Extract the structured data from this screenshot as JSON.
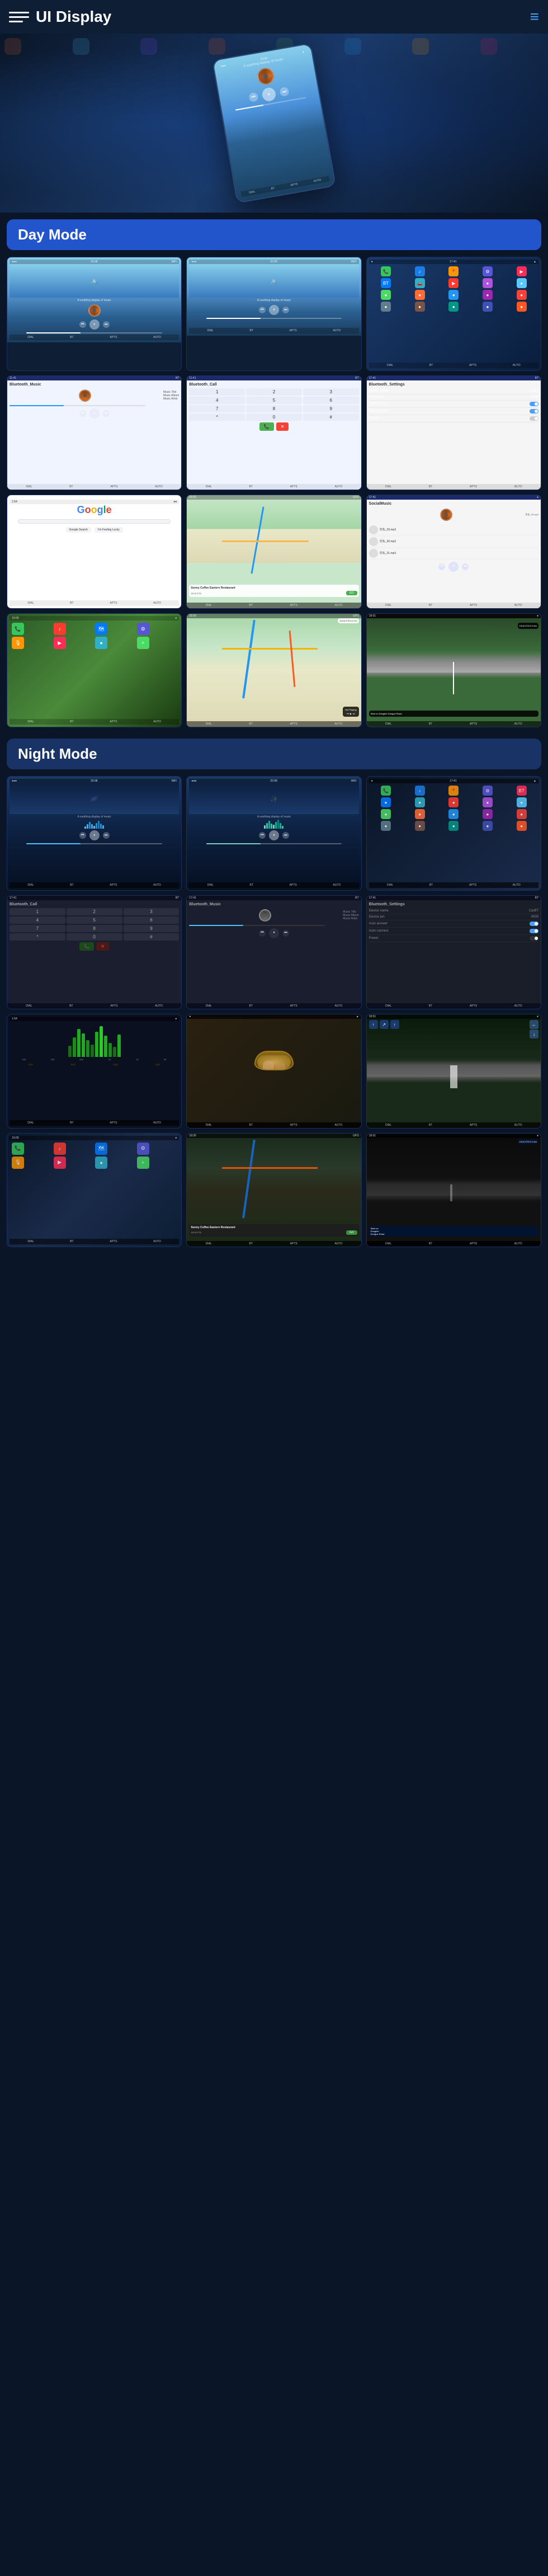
{
  "app": {
    "title": "UI Display",
    "menu_icon": "≡",
    "hamburger_lines": 3
  },
  "header": {
    "title": "UI Display",
    "nav_color": "#4a9eff"
  },
  "sections": {
    "day_mode": "Day Mode",
    "night_mode": "Night Mode"
  },
  "day_screens": {
    "music1": {
      "time": "20:08",
      "subtitle": "A soothing display of music",
      "controls": [
        "⏮",
        "⏸",
        "⏭"
      ]
    },
    "music2": {
      "time": "20:08",
      "subtitle": "A soothing display of music"
    },
    "bluetooth_music": {
      "title": "Bluetooth_Music",
      "track_title": "Music Title",
      "album": "Music Album",
      "artist": "Music Artist"
    },
    "bluetooth_call": {
      "title": "Bluetooth_Call",
      "numbers": [
        "1",
        "2",
        "3",
        "4",
        "5",
        "6",
        "7",
        "8",
        "9",
        "*",
        "0",
        "#"
      ]
    },
    "bluetooth_settings": {
      "title": "Bluetooth_Settings",
      "device_name_label": "Device name",
      "device_name_value": "CarBT",
      "device_pin_label": "Device pin",
      "device_pin_value": "0000",
      "auto_answer_label": "Auto answer",
      "auto_connect_label": "Auto connect",
      "power_label": "Power"
    },
    "google": {
      "logo": "Google",
      "logo_parts": [
        "G",
        "o",
        "o",
        "g",
        "l",
        "e"
      ]
    },
    "map_navigation": {
      "title": "Navigation",
      "poi": "Sunny Coffee Eastern Restaurant",
      "eta_label": "18:16 ETA",
      "distance": "GO"
    },
    "social_music": {
      "title": "SocialMusic",
      "tracks": [
        "华东_29.mp3",
        "华东_30.mp3",
        "华东_31.mp3"
      ]
    },
    "gps_info": {
      "distance": "10/16 ETA  9.0 km",
      "road": "Start on Donglee Dongue Road"
    },
    "not_playing": "Not Playing"
  },
  "night_screens": {
    "music1": {
      "time": "20:08",
      "subtitle": "A soothing display of music"
    },
    "music2": {
      "time": "20:08",
      "subtitle": "A soothing display of music"
    },
    "bluetooth_call": {
      "title": "Bluetooth_Call",
      "numbers": [
        "1",
        "2",
        "3",
        "4",
        "5",
        "6",
        "7",
        "8",
        "9",
        "*",
        "0",
        "#"
      ]
    },
    "bluetooth_music": {
      "title": "Bluetooth_Music",
      "track_title": "Music Title",
      "album": "Music Album",
      "artist": "Music Artist"
    },
    "bluetooth_settings": {
      "title": "Bluetooth_Settings",
      "device_name_label": "Device name",
      "device_name_value": "CarBT",
      "device_pin_label": "Device pin",
      "device_pin_value": "0000",
      "auto_answer_label": "Auto answer",
      "auto_connect_label": "Auto connect",
      "power_label": "Power"
    }
  },
  "colors": {
    "primary_blue": "#2255aa",
    "dark_bg": "#0a1628",
    "accent": "#4a9eff",
    "day_mode_bg": "#1e55cc",
    "night_mode_bg": "#1a3366"
  }
}
